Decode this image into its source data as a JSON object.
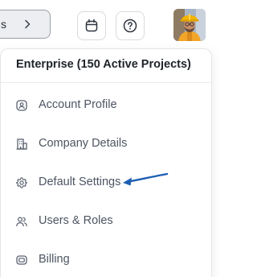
{
  "topbar": {
    "pill_text": "s",
    "chevron_icon": "chevron-right-icon",
    "calendar_icon": "calendar-icon",
    "help_icon": "help-circle-icon",
    "avatar_icon": "user-avatar-construction-worker"
  },
  "menu": {
    "title": "Enterprise (150 Active Projects)",
    "items": [
      {
        "label": "Account Profile",
        "icon": "account-profile-icon"
      },
      {
        "label": "Company Details",
        "icon": "building-icon"
      },
      {
        "label": "Default Settings",
        "icon": "gear-icon"
      },
      {
        "label": "Users & Roles",
        "icon": "users-icon"
      },
      {
        "label": "Billing",
        "icon": "billing-icon"
      }
    ]
  },
  "annotation": {
    "arrow_color": "#1e5fb3",
    "points_to": "Default Settings"
  },
  "colors": {
    "text_primary": "#1f2329",
    "text_secondary": "#4d5562",
    "icon": "#5a6270",
    "border": "#e3e6ea"
  }
}
